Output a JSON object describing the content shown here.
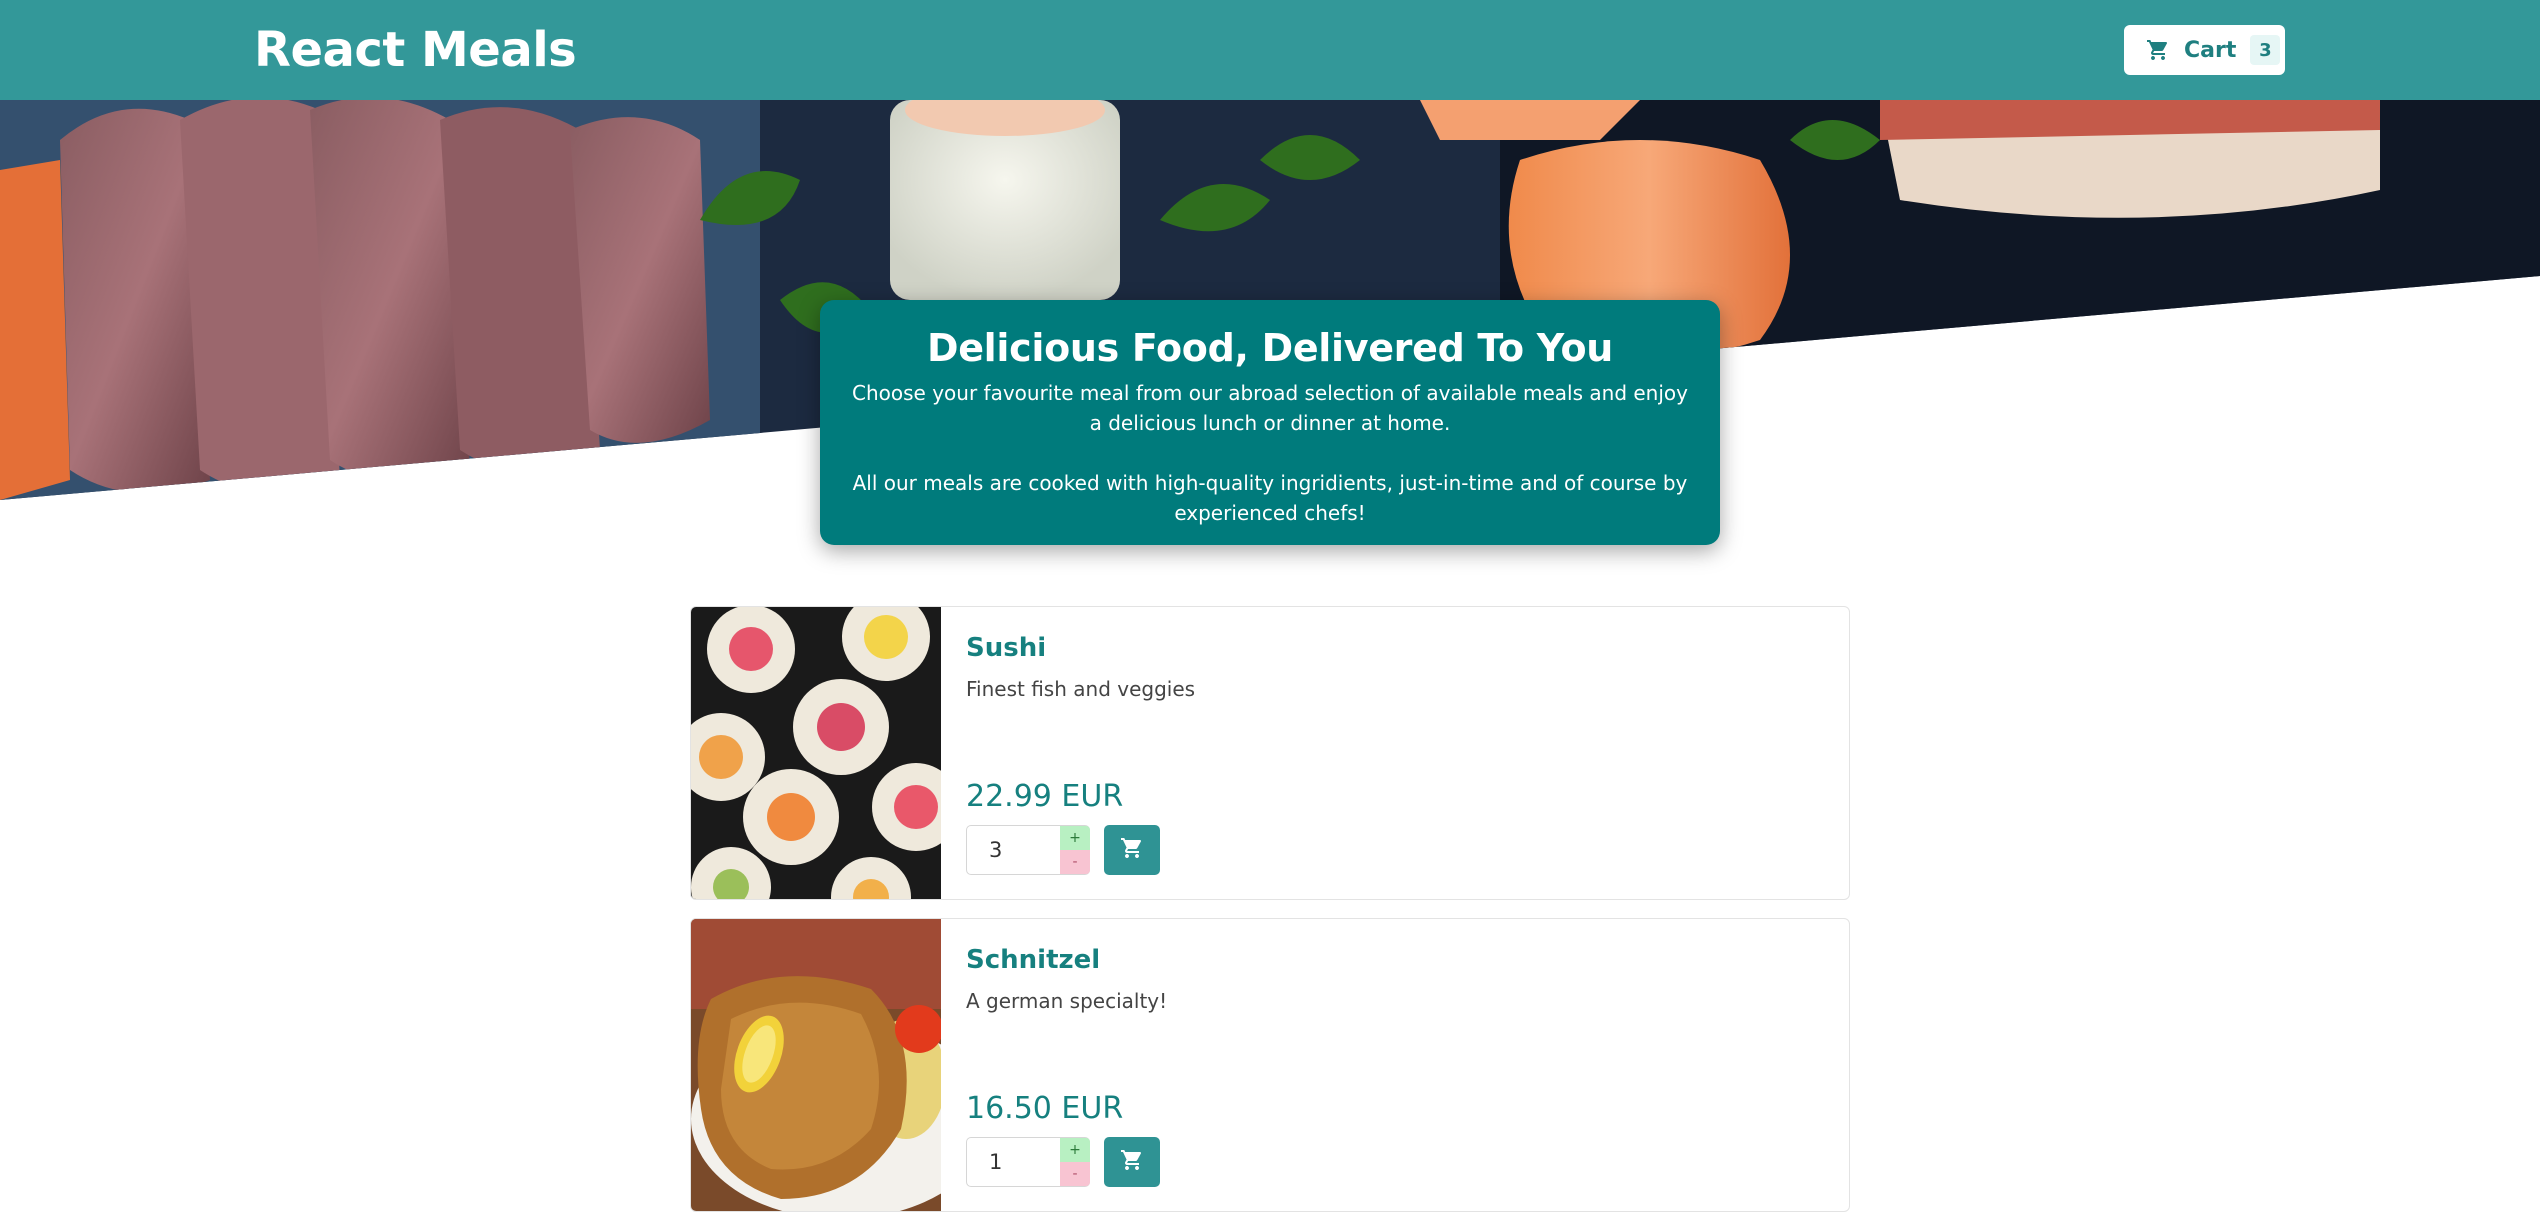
{
  "header": {
    "brand": "React Meals",
    "cart": {
      "label": "Cart",
      "count": "3",
      "icon": "shopping-cart-icon"
    }
  },
  "hero": {
    "image": "sushi-and-sashimi-platter-photo"
  },
  "summary": {
    "title": "Delicious Food, Delivered To You",
    "paragraph1": "Choose your favourite meal from our abroad selection of available meals and enjoy a delicious lunch or dinner at home.",
    "paragraph2": "All our meals are cooked with high-quality ingridients, just-in-time and of course by experienced chefs!"
  },
  "meals": [
    {
      "name": "Sushi",
      "description": "Finest fish and veggies",
      "price": "22.99 EUR",
      "quantity": "3",
      "plus": "+",
      "minus": "-",
      "image": "sushi-rolls-photo"
    },
    {
      "name": "Schnitzel",
      "description": "A german specialty!",
      "price": "16.50 EUR",
      "quantity": "1",
      "plus": "+",
      "minus": "-",
      "image": "schnitzel-with-lemon-photo"
    }
  ],
  "colors": {
    "header": "#339899",
    "summary": "#007b7c",
    "accent": "#16807f",
    "add_button": "#2f9394",
    "plus": "#b8f0c2",
    "minus": "#f8c4d2"
  }
}
